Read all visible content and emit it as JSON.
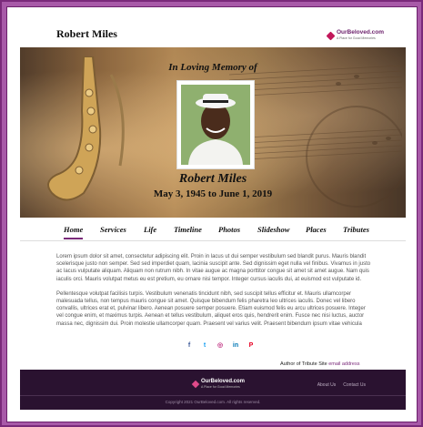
{
  "header": {
    "site_name": "Robert Miles",
    "brand_name": "OurBeloved.com",
    "brand_tagline": "A Place for Good Memories"
  },
  "hero": {
    "memory_title": "In Loving Memory of",
    "name": "Robert Miles",
    "dates": "May 3, 1945 to June 1, 2019"
  },
  "nav": {
    "items": [
      "Home",
      "Services",
      "Life",
      "Timeline",
      "Photos",
      "Slideshow",
      "Places",
      "Tributes"
    ],
    "active": "Home"
  },
  "content": {
    "paragraphs": [
      "Lorem ipsum dolor sit amet, consectetur adipiscing elit. Proin in lacus ut dui semper vestibulum sed blandit purus. Mauris blandit scelerisque justo non semper. Sed sed imperdiet quam, lacinia suscipit ante. Sed dignissim eget nulla vel finibus. Vivamus in justo ac lacus vulputate aliquam. Aliquam non rutrum nibh. In vitae augue ac magna porttitor congue sit amet sit amet augue. Nam quis iaculis orci. Mauris volutpat metus eu est pretium, eu ornare nisi tempor. Integer cursus iaculis dui, at euismod est vulputate id.",
      "Pellentesque volutpat facilisis turpis. Vestibulum venenatis tincidunt nibh, sed suscipit tellus efficitur et. Mauris ullamcorper malesuada tellus, non tempus mauris congue sit amet. Quisque bibendum felis pharetra leo ultrices iaculis. Donec vel libero convallis, ultrices erat et, pulvinar libero. Aenean posuere semper posuere. Etiam euismod felis eu arcu ultrices posuere. Integer vel congue enim, et maximus turpis. Aenean et tellus vestibulum, aliquet eros quis, hendrerit enim. Fusce nec nisi luctus, auctor massa nec, dignissim dui. Proin molestie ullamcorper quam. Praesent vel varius velit. Praesent bibendum ipsum vitae vehicula"
    ]
  },
  "social": {
    "icons": [
      "facebook-icon",
      "twitter-icon",
      "instagram-icon",
      "linkedin-icon",
      "pinterest-icon"
    ],
    "glyphs": [
      "f",
      "t",
      "◎",
      "in",
      "P"
    ],
    "colors": [
      "#3b5998",
      "#1da1f2",
      "#c13584",
      "#0077b5",
      "#e60023"
    ]
  },
  "author": {
    "label": "Author of Tribute Site",
    "email": "email address"
  },
  "footer": {
    "brand_name": "OurBeloved.com",
    "brand_tagline": "A Place for Good Memories",
    "links": [
      "About Us",
      "Contact Us"
    ],
    "copyright": "Copyright 2021 OurBeloved.com. All rights reserved."
  },
  "colors": {
    "accent": "#7a2a7a",
    "footer_bg": "#2a1230",
    "brand_pink": "#c2185b"
  }
}
